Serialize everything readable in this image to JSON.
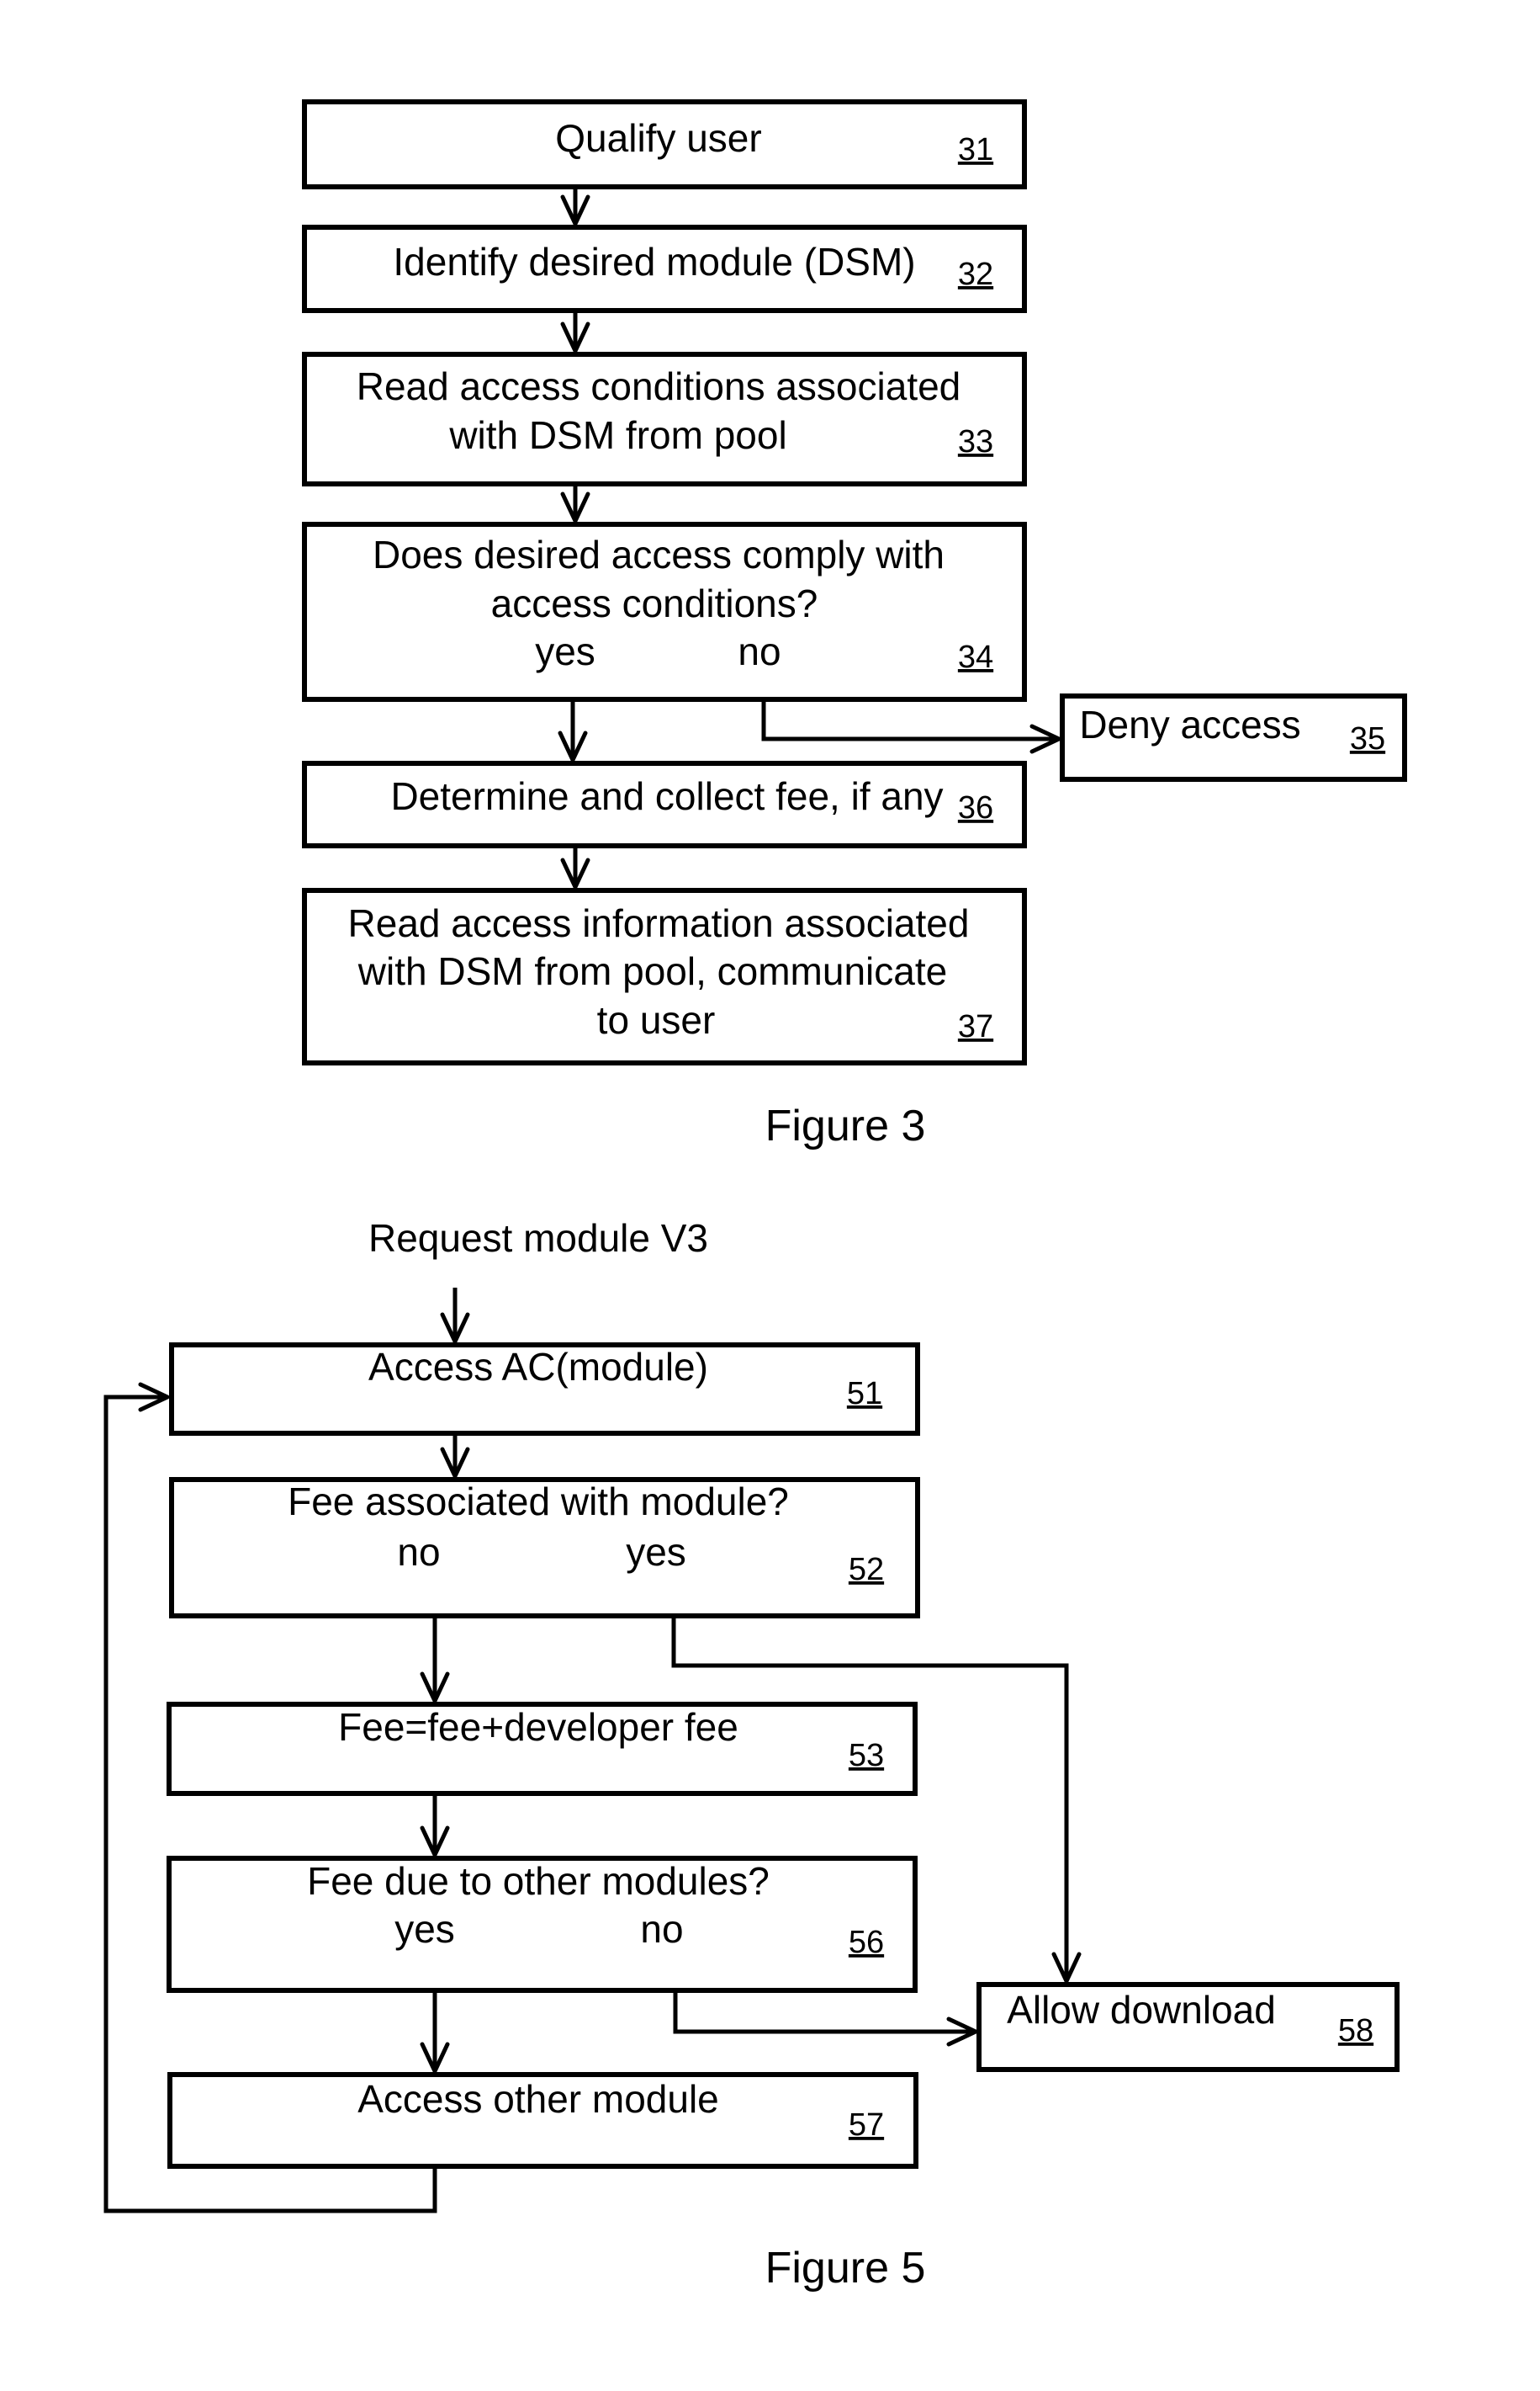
{
  "figure3": {
    "caption": "Figure 3",
    "steps": [
      {
        "ref": "31",
        "lines": [
          "Qualify user"
        ]
      },
      {
        "ref": "32",
        "lines": [
          "Identify desired module (DSM)"
        ]
      },
      {
        "ref": "33",
        "lines": [
          "Read access conditions associated",
          "with DSM from pool"
        ]
      },
      {
        "ref": "34",
        "lines": [
          "Does desired access comply with",
          "access conditions?"
        ],
        "branches": {
          "yes": "yes",
          "no": "no"
        }
      },
      {
        "ref": "35",
        "lines": [
          "Deny access"
        ]
      },
      {
        "ref": "36",
        "lines": [
          "Determine and collect fee, if any"
        ]
      },
      {
        "ref": "37",
        "lines": [
          "Read access information associated",
          "with DSM from pool, communicate",
          "to user"
        ]
      }
    ]
  },
  "figure5": {
    "caption": "Figure 5",
    "start_label": "Request module V3",
    "steps": [
      {
        "ref": "51",
        "lines": [
          "Access AC(module)"
        ]
      },
      {
        "ref": "52",
        "lines": [
          "Fee associated with module?"
        ],
        "branches": {
          "no": "no",
          "yes": "yes"
        }
      },
      {
        "ref": "53",
        "lines": [
          "Fee=fee+developer fee"
        ]
      },
      {
        "ref": "56",
        "lines": [
          "Fee due to other modules?"
        ],
        "branches": {
          "yes": "yes",
          "no": "no"
        }
      },
      {
        "ref": "57",
        "lines": [
          "Access other module"
        ]
      },
      {
        "ref": "58",
        "lines": [
          "Allow download"
        ]
      }
    ]
  }
}
